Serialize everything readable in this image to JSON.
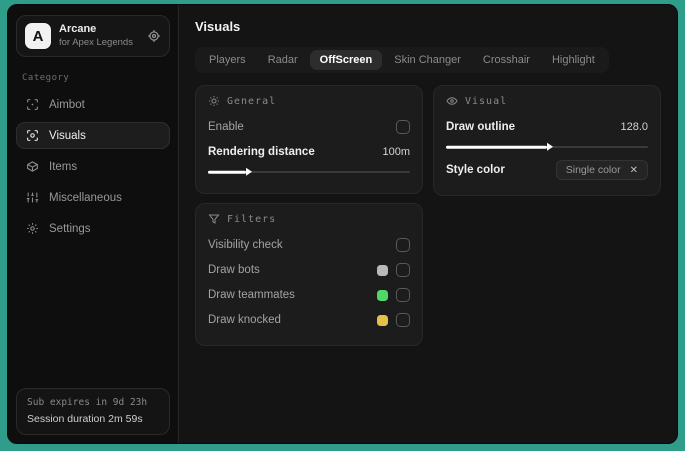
{
  "sidebar": {
    "app_name": "Arcane",
    "app_subtitle": "for Apex Legends",
    "logo_letter": "A",
    "category_label": "Category",
    "items": [
      {
        "label": "Aimbot"
      },
      {
        "label": "Visuals"
      },
      {
        "label": "Items"
      },
      {
        "label": "Miscellaneous"
      },
      {
        "label": "Settings"
      }
    ],
    "footer": {
      "line1": "Sub expires in 9d 23h",
      "line2": "Session duration 2m 59s"
    }
  },
  "main": {
    "title": "Visuals",
    "tabs": [
      {
        "label": "Players"
      },
      {
        "label": "Radar"
      },
      {
        "label": "OffScreen"
      },
      {
        "label": "Skin Changer"
      },
      {
        "label": "Crosshair"
      },
      {
        "label": "Highlight"
      }
    ],
    "active_tab": "OffScreen",
    "general": {
      "title": "General",
      "enable_label": "Enable",
      "rendering_distance_label": "Rendering distance",
      "rendering_distance_value": "100m",
      "rendering_distance_percent": "19"
    },
    "visual": {
      "title": "Visual",
      "draw_outline_label": "Draw outline",
      "draw_outline_value": "128.0",
      "draw_outline_percent": "50",
      "style_color_label": "Style color",
      "style_color_value": "Single color",
      "clear_glyph": "✕"
    },
    "filters": {
      "title": "Filters",
      "rows": [
        {
          "label": "Visibility check",
          "swatch": ""
        },
        {
          "label": "Draw bots",
          "swatch": "#b9b9b9"
        },
        {
          "label": "Draw teammates",
          "swatch": "#4fd867"
        },
        {
          "label": "Draw knocked",
          "swatch": "#e2c24a"
        }
      ]
    }
  },
  "colors": {
    "accent_background": "#2f9d89",
    "swatch_bots": "#b9b9b9",
    "swatch_teammates": "#4fd867",
    "swatch_knocked": "#e2c24a"
  }
}
